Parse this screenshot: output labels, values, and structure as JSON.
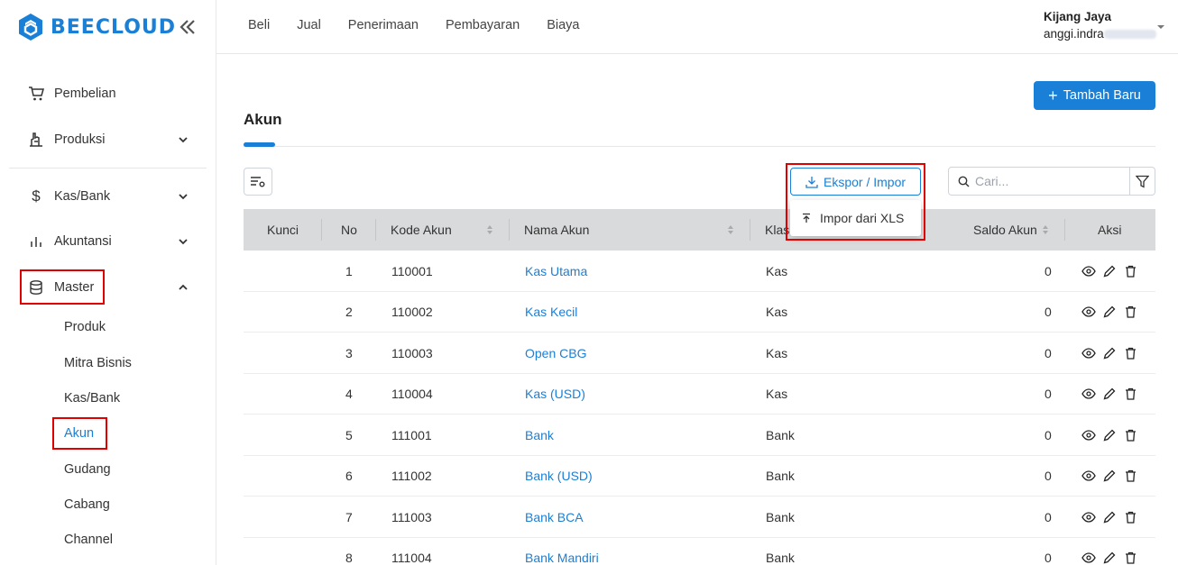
{
  "brand": {
    "name": "BEECLOUD",
    "color": "#1a7fd6"
  },
  "sidebar": {
    "items": [
      {
        "label": "Pembelian",
        "icon": "cart-icon"
      },
      {
        "label": "Produksi",
        "icon": "factory-icon"
      },
      {
        "label": "Kas/Bank",
        "icon": "dollar-icon"
      },
      {
        "label": "Akuntansi",
        "icon": "bar-chart-icon"
      },
      {
        "label": "Master",
        "icon": "database-icon"
      }
    ],
    "master_sub": [
      "Produk",
      "Mitra Bisnis",
      "Kas/Bank",
      "Akun",
      "Gudang",
      "Cabang",
      "Channel"
    ],
    "active_sub": "Akun"
  },
  "topnav": [
    "Beli",
    "Jual",
    "Penerimaan",
    "Pembayaran",
    "Biaya"
  ],
  "user": {
    "name": "Kijang Jaya",
    "email_visible": "anggi.indra"
  },
  "page": {
    "title": "Akun",
    "add_button": "Tambah Baru",
    "export_button": "Ekspor / Impor",
    "dropdown_item": "Impor dari XLS",
    "search_placeholder": "Cari..."
  },
  "table": {
    "headers": [
      "Kunci",
      "No",
      "Kode Akun",
      "Nama Akun",
      "Klas",
      "Saldo Akun",
      "Aksi"
    ],
    "rows": [
      {
        "no": "1",
        "kode": "110001",
        "nama": "Kas Utama",
        "klas": "Kas",
        "saldo": "0"
      },
      {
        "no": "2",
        "kode": "110002",
        "nama": "Kas Kecil",
        "klas": "Kas",
        "saldo": "0"
      },
      {
        "no": "3",
        "kode": "110003",
        "nama": "Open CBG",
        "klas": "Kas",
        "saldo": "0"
      },
      {
        "no": "4",
        "kode": "110004",
        "nama": "Kas (USD)",
        "klas": "Kas",
        "saldo": "0"
      },
      {
        "no": "5",
        "kode": "111001",
        "nama": "Bank",
        "klas": "Bank",
        "saldo": "0"
      },
      {
        "no": "6",
        "kode": "111002",
        "nama": "Bank (USD)",
        "klas": "Bank",
        "saldo": "0"
      },
      {
        "no": "7",
        "kode": "111003",
        "nama": "Bank BCA",
        "klas": "Bank",
        "saldo": "0"
      },
      {
        "no": "8",
        "kode": "111004",
        "nama": "Bank Mandiri",
        "klas": "Bank",
        "saldo": "0"
      }
    ]
  }
}
